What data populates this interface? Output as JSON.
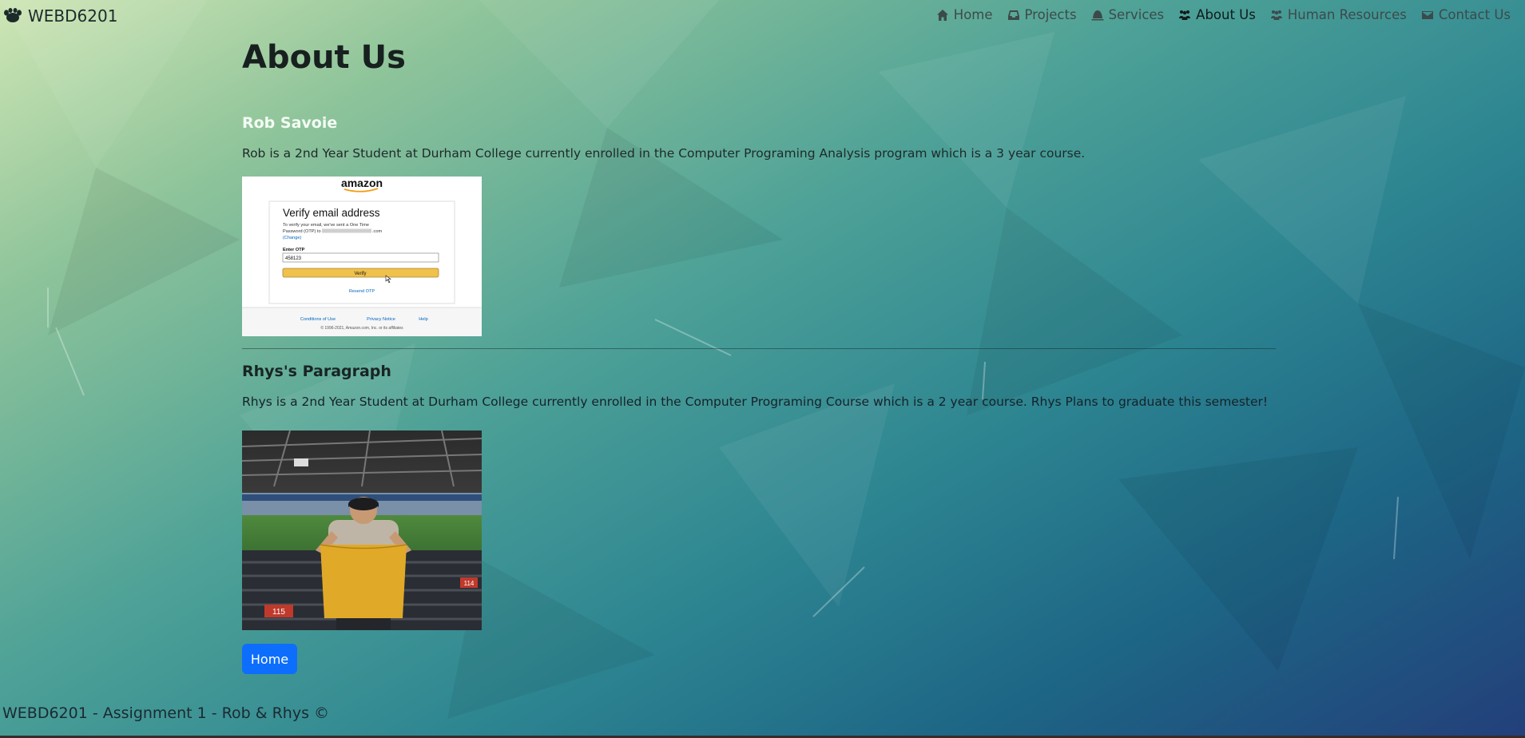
{
  "brand": {
    "name": "WEBD6201",
    "icon": "paw-icon"
  },
  "nav": [
    {
      "label": "Home",
      "icon": "house-icon",
      "active": false
    },
    {
      "label": "Projects",
      "icon": "inbox-icon",
      "active": false
    },
    {
      "label": "Services",
      "icon": "bell-icon",
      "active": false
    },
    {
      "label": "About Us",
      "icon": "people-icon",
      "active": true
    },
    {
      "label": "Human Resources",
      "icon": "people-icon",
      "active": false
    },
    {
      "label": "Contact Us",
      "icon": "envelope-icon",
      "active": false
    }
  ],
  "page": {
    "title": "About Us"
  },
  "rob": {
    "heading": "Rob Savoie",
    "paragraph": "Rob is a 2nd Year Student at Durham College currently enrolled in the Computer Programing Analysis program which is a 3 year course.",
    "image": {
      "logo": "amazon",
      "title": "Verify email address",
      "text_line1": "To verify your email, we've sent a One Time",
      "text_line2": "Password (OTP) to",
      "email_suffix": ".com",
      "change_link": "(Change)",
      "otp_label": "Enter OTP",
      "otp_value": "458123",
      "verify_button": "Verify",
      "resend_link": "Resend OTP",
      "footer_links": [
        "Conditions of Use",
        "Privacy Notice",
        "Help"
      ],
      "copyright": "© 1996-2021, Amazon.com, Inc. or its affiliates"
    }
  },
  "rhys": {
    "heading": "Rhys's Paragraph",
    "paragraph": "Rhys is a 2nd Year Student at Durham College currently enrolled in the Computer Programing Course which is a 2 year course. Rhys Plans to graduate this semester!",
    "image": {
      "section_left": "115",
      "section_right": "114"
    }
  },
  "home_button": "Home",
  "footer": "WEBD6201 - Assignment 1 - Rob & Rhys ©"
}
